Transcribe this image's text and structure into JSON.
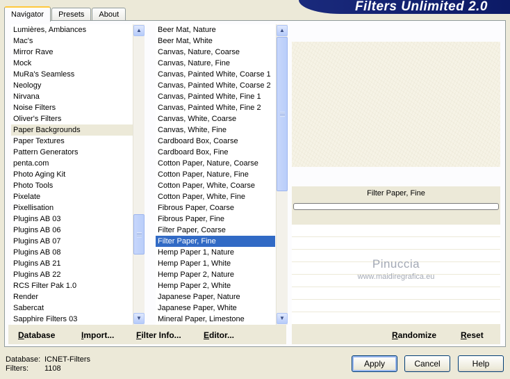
{
  "banner": {
    "title": "Filters Unlimited 2.0"
  },
  "tabs": [
    {
      "label": "Navigator",
      "active": true
    },
    {
      "label": "Presets",
      "active": false
    },
    {
      "label": "About",
      "active": false
    }
  ],
  "categories": {
    "items": [
      "Lumières, Ambiances",
      "Mac's",
      "Mirror Rave",
      "Mock",
      "MuRa's Seamless",
      "Neology",
      "Nirvana",
      "Noise Filters",
      "Oliver's Filters",
      "Paper Backgrounds",
      "Paper Textures",
      "Pattern Generators",
      "penta.com",
      "Photo Aging Kit",
      "Photo Tools",
      "Pixelate",
      "Pixellisation",
      "Plugins AB 03",
      "Plugins AB 06",
      "Plugins AB 07",
      "Plugins AB 08",
      "Plugins AB 21",
      "Plugins AB 22",
      "RCS Filter Pak 1.0",
      "Render",
      "Sabercat",
      "Sapphire Filters 03"
    ],
    "selected": "Paper Backgrounds"
  },
  "filters": {
    "items": [
      "Beer Mat, Nature",
      "Beer Mat, White",
      "Canvas, Nature, Coarse",
      "Canvas, Nature, Fine",
      "Canvas, Painted White, Coarse 1",
      "Canvas, Painted White, Coarse 2",
      "Canvas, Painted White, Fine 1",
      "Canvas, Painted White, Fine 2",
      "Canvas, White, Coarse",
      "Canvas, White, Fine",
      "Cardboard Box, Coarse",
      "Cardboard Box, Fine",
      "Cotton Paper, Nature, Coarse",
      "Cotton Paper, Nature, Fine",
      "Cotton Paper, White, Coarse",
      "Cotton Paper, White, Fine",
      "Fibrous Paper, Coarse",
      "Fibrous Paper, Fine",
      "Filter Paper, Coarse",
      "Filter Paper, Fine",
      "Hemp Paper 1, Nature",
      "Hemp Paper 1, White",
      "Hemp Paper 2, Nature",
      "Hemp Paper 2, White",
      "Japanese Paper, Nature",
      "Japanese Paper, White",
      "Mineral Paper, Limestone"
    ],
    "selected": "Filter Paper, Fine"
  },
  "preview": {
    "filter_name": "Filter Paper, Fine",
    "watermark_title": "Pinuccia",
    "watermark_url": "www.maidiregrafica.eu"
  },
  "commands": {
    "database": "Database",
    "import": "Import...",
    "filter_info": "Filter Info...",
    "editor": "Editor...",
    "randomize": "Randomize",
    "reset": "Reset"
  },
  "status": {
    "database_label": "Database:",
    "database_value": "ICNET-Filters",
    "filters_label": "Filters:",
    "filters_value": "1108"
  },
  "buttons": {
    "apply": "Apply",
    "cancel": "Cancel",
    "help": "Help"
  },
  "colors": {
    "selection": "#316ac5",
    "banner": "#0c1a66",
    "panel": "#ece9d8"
  }
}
